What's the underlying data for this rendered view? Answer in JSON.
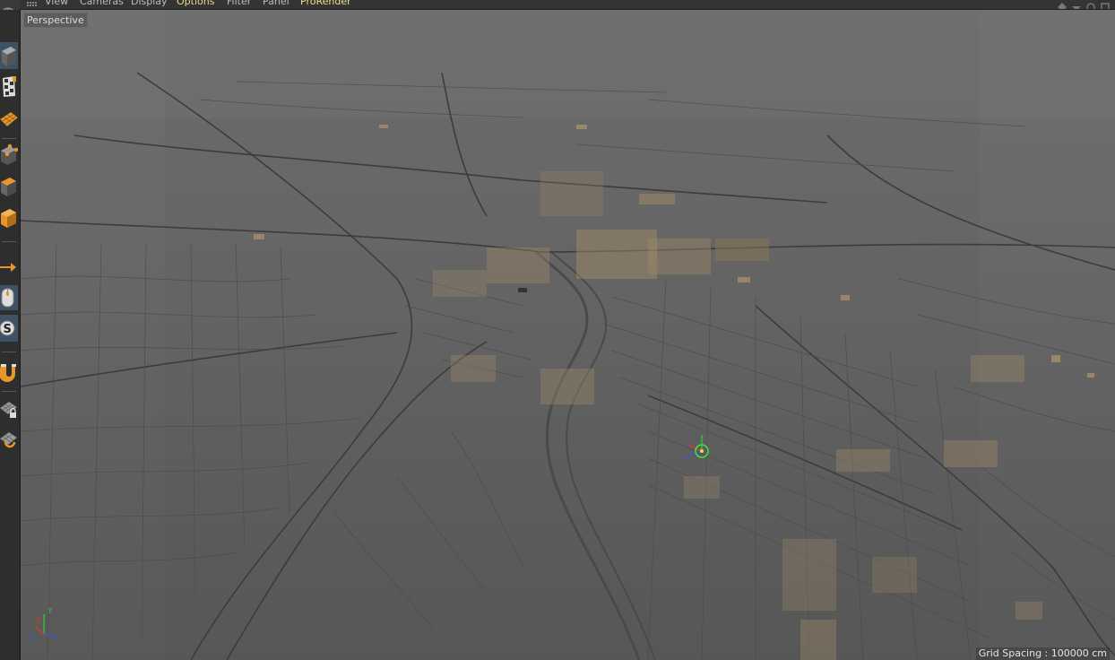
{
  "menubar": {
    "items": [
      {
        "label": "View"
      },
      {
        "label": "Cameras"
      },
      {
        "label": "Display"
      },
      {
        "label": "Options"
      },
      {
        "label": "Filter"
      },
      {
        "label": "Panel"
      },
      {
        "label": "ProRender"
      }
    ]
  },
  "toolbar": {
    "tools": [
      {
        "icon": "cube-icon"
      },
      {
        "icon": "checker-icon"
      },
      {
        "icon": "plane-grid-icon"
      },
      {
        "icon": "polygon-cube-icon"
      },
      {
        "icon": "box-icon"
      },
      {
        "icon": "filled-cube-icon"
      },
      {
        "icon": "arrow-right-icon"
      },
      {
        "icon": "mouse-icon"
      },
      {
        "icon": "snap-s-icon"
      },
      {
        "icon": "magnet-icon"
      },
      {
        "icon": "grid-lock-icon"
      },
      {
        "icon": "grid-snap-icon"
      }
    ]
  },
  "viewport": {
    "label": "Perspective",
    "grid_spacing": "Grid Spacing : 100000 cm",
    "axis": {
      "x": "X",
      "y": "Y",
      "z": "Z"
    },
    "colors": {
      "building": "#a08a6a",
      "road": "#3e3e3e",
      "axis_x": "#d03a2a",
      "axis_y": "#3ab83a",
      "axis_z": "#3a5ad0"
    }
  }
}
